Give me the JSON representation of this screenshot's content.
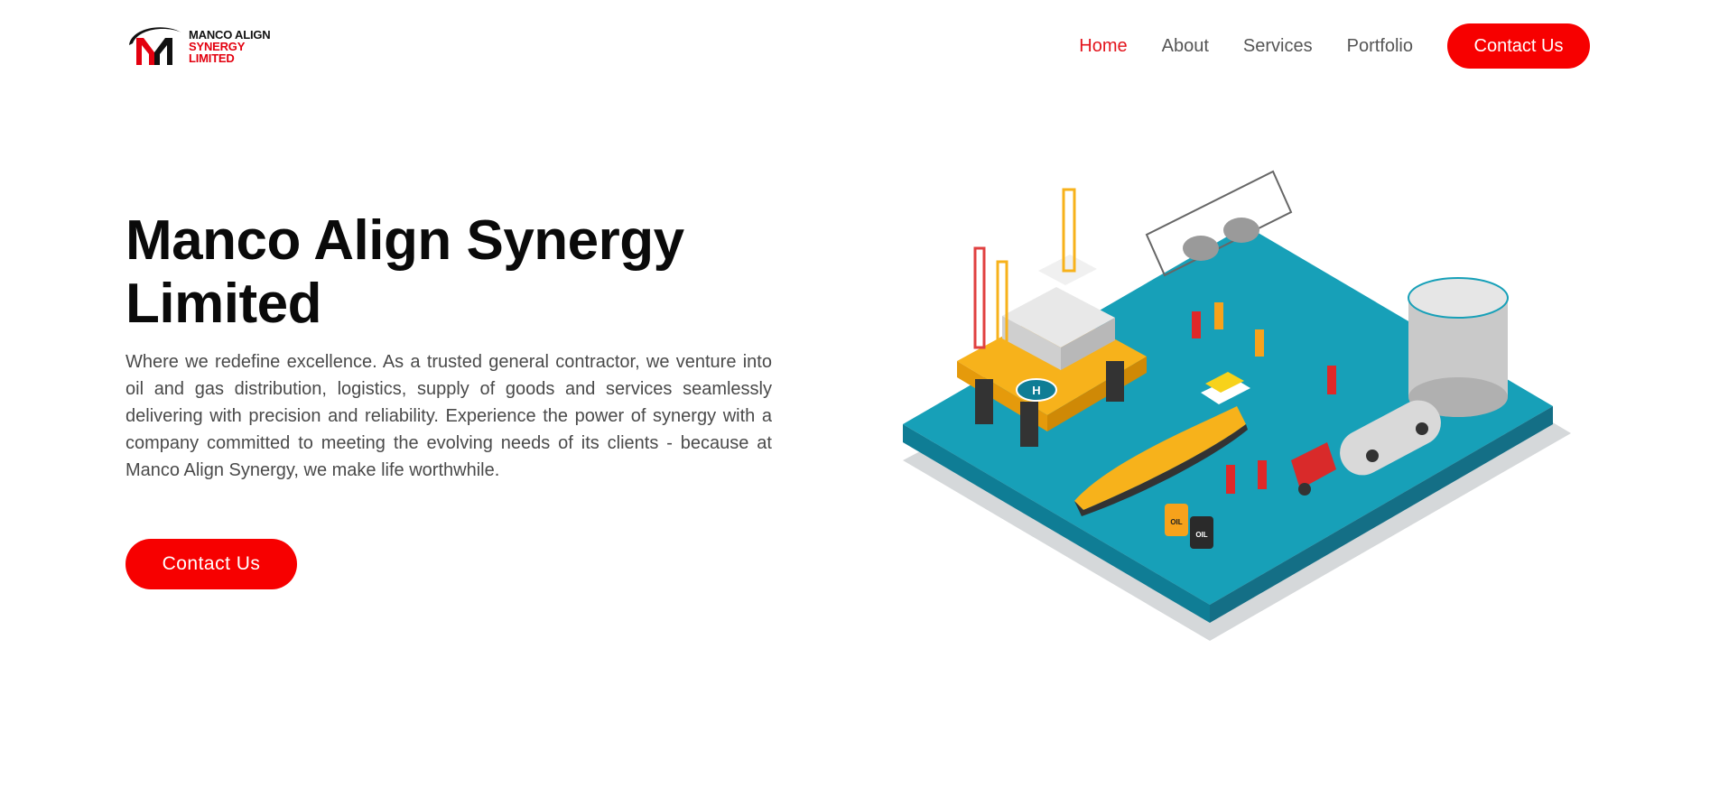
{
  "brand": {
    "line1": "MANCO ALIGN",
    "line2": "SYNERGY",
    "line3": "LIMITED",
    "logo_icon": "m-monogram-logo",
    "colors": {
      "red": "#e3000f",
      "black": "#111111"
    }
  },
  "nav": {
    "items": [
      {
        "label": "Home",
        "active": true
      },
      {
        "label": "About",
        "active": false
      },
      {
        "label": "Services",
        "active": false
      },
      {
        "label": "Portfolio",
        "active": false
      }
    ],
    "cta_label": "Contact Us"
  },
  "hero": {
    "title_line1": "Manco Align Synergy",
    "title_line2": "Limited",
    "description": "Where we redefine excellence. As a trusted general contractor, we venture into oil and gas distribution, logistics, supply of goods and services seamlessly delivering with precision and reliability. Experience the power of synergy with a company committed to meeting the evolving needs of its clients - because at Manco Align Synergy, we make life worthwhile.",
    "cta_label": "Contact Us",
    "accent_color": "#f70000"
  },
  "illustration": {
    "icon": "oil-and-gas-isometric-illustration",
    "helipad_label": "H",
    "barrel_label_1": "OIL",
    "barrel_label_2": "OIL"
  }
}
